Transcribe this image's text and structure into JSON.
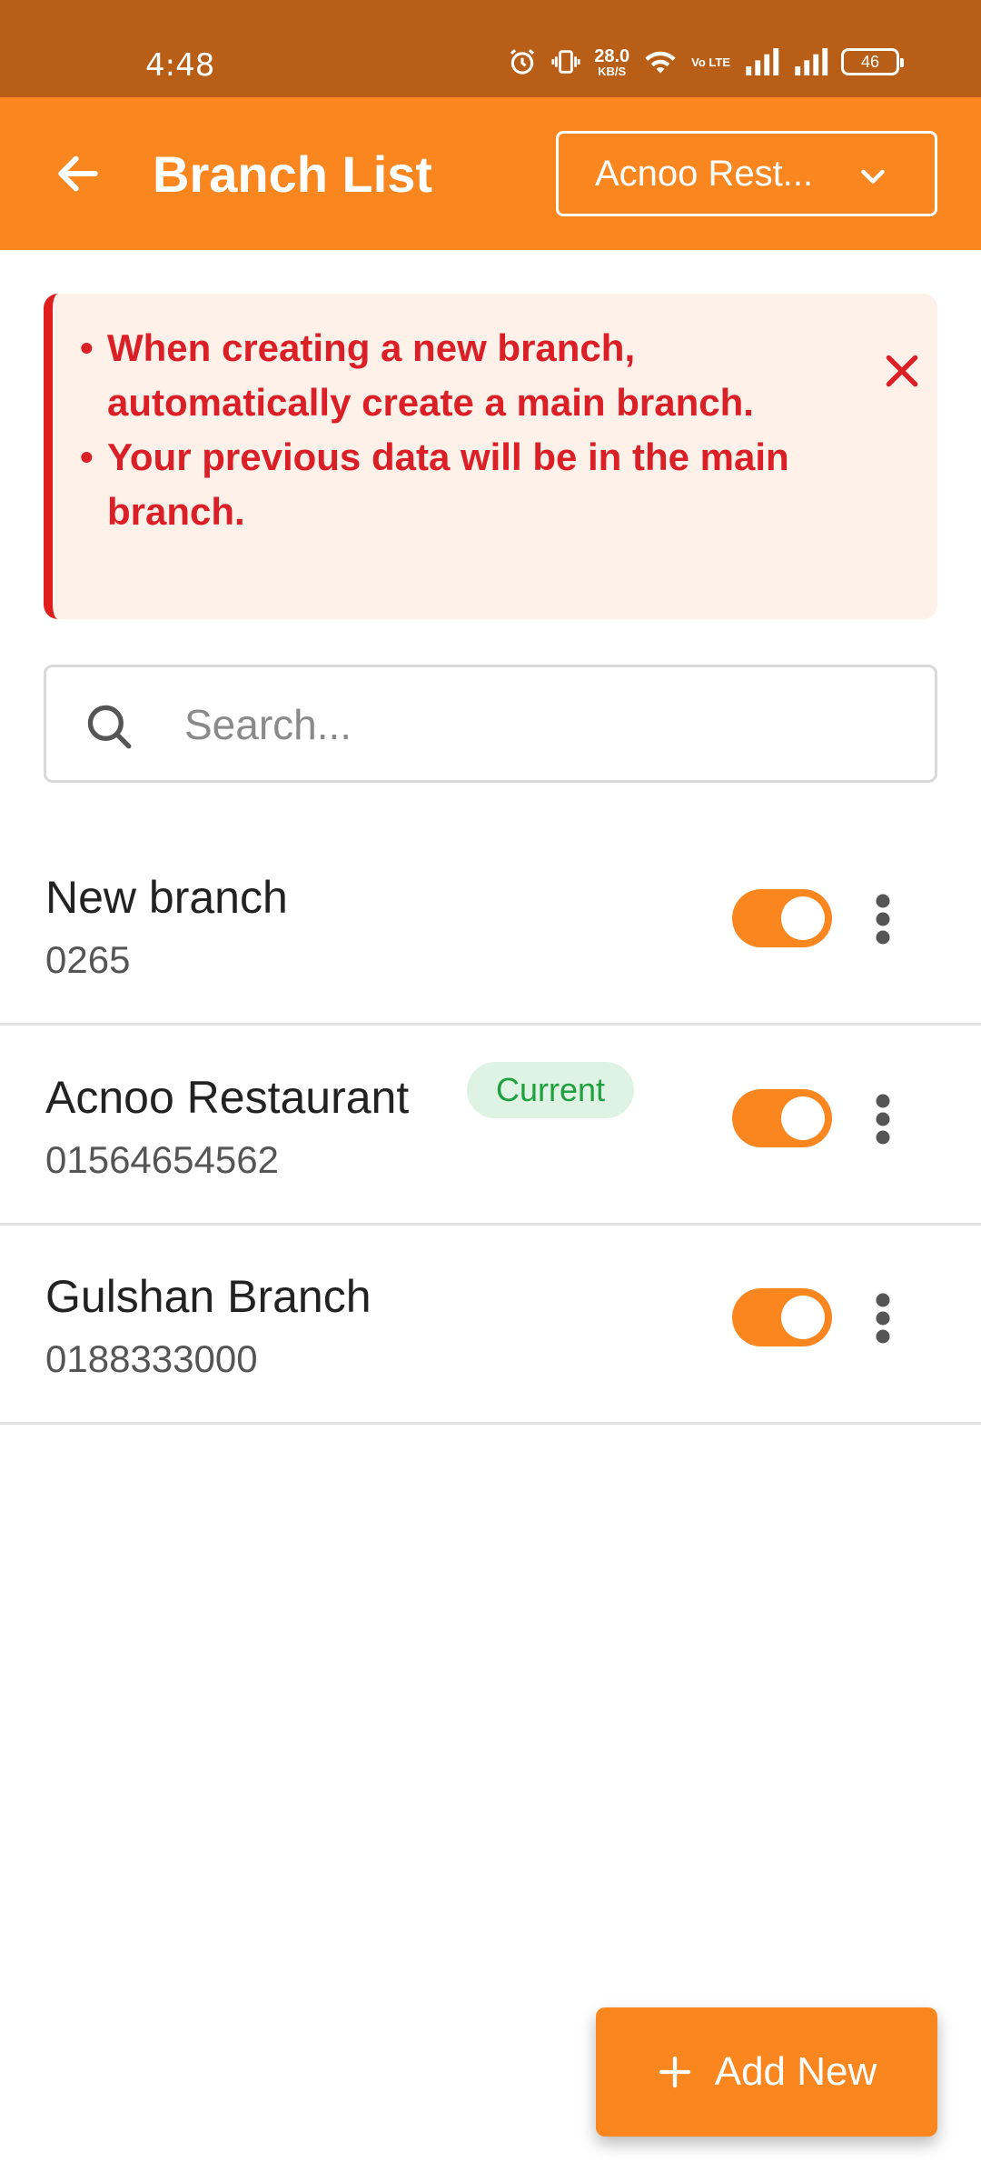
{
  "status_bar": {
    "time": "4:48",
    "net_speed_value": "28.0",
    "net_speed_unit": "KB/S",
    "volte_label": "Vo LTE",
    "battery": "46"
  },
  "app_bar": {
    "title": "Branch List",
    "branch_selector": "Acnoo Rest..."
  },
  "alert": {
    "items": [
      "When creating a new branch, automatically create a main branch.",
      "Your previous data will be in the main branch."
    ]
  },
  "search": {
    "placeholder": "Search..."
  },
  "branches": [
    {
      "name": "New branch",
      "phone": "0265",
      "current": false,
      "enabled": true
    },
    {
      "name": "Acnoo Restaurant",
      "phone": "01564654562",
      "current": true,
      "badge": "Current",
      "enabled": true
    },
    {
      "name": "Gulshan Branch",
      "phone": "0188333000",
      "current": false,
      "enabled": true
    }
  ],
  "fab": {
    "label": "Add New"
  },
  "colors": {
    "status_bar": "#B95E16",
    "primary": "#FA8620",
    "alert_bg": "#FDF1E9",
    "alert_text": "#DA1F26",
    "badge_bg": "#DFF3E4",
    "badge_text": "#1FA03F"
  }
}
